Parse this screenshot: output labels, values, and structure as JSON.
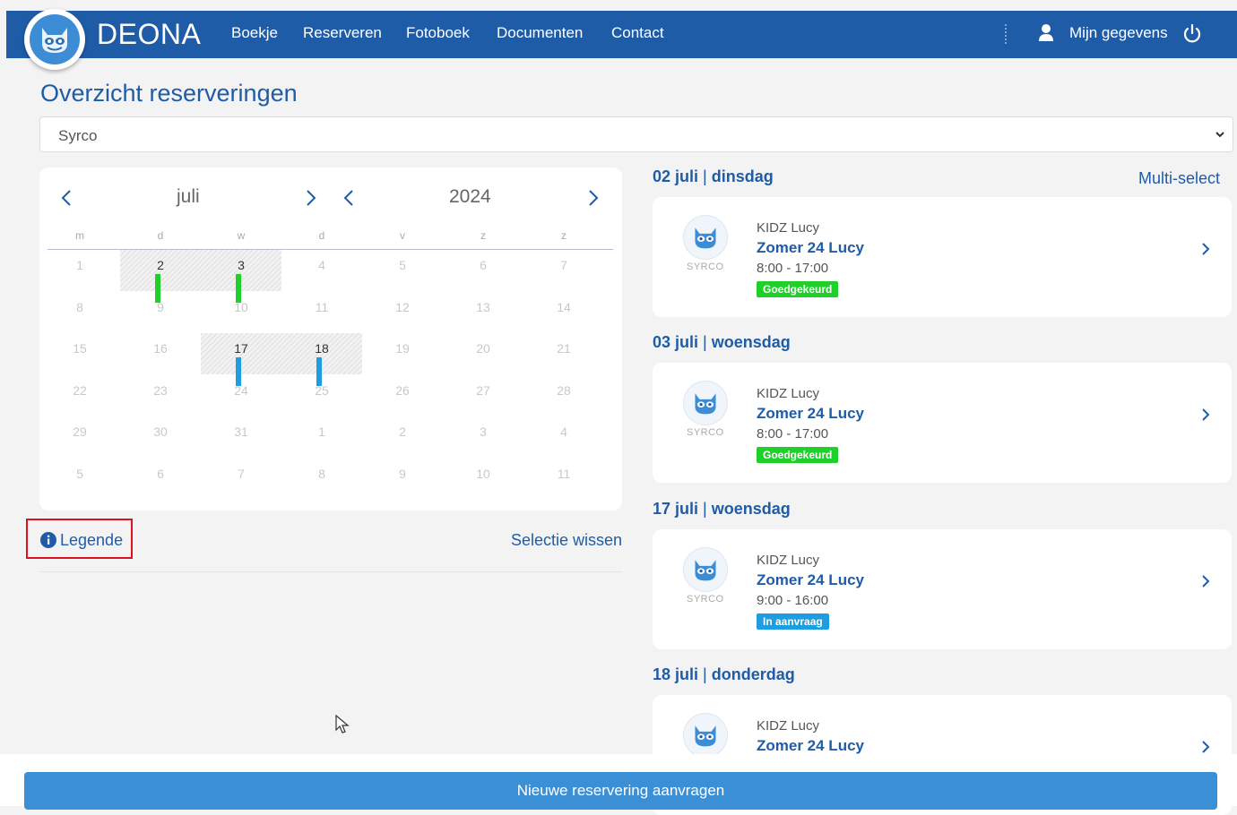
{
  "brand": "DEONA",
  "nav": [
    "Boekje",
    "Reserveren",
    "Fotoboek",
    "Documenten",
    "Contact"
  ],
  "user": {
    "label": "Mijn gegevens"
  },
  "page_title": "Overzicht reserveringen",
  "location_select": {
    "value": "Syrco"
  },
  "calendar": {
    "month": "juli",
    "year": "2024",
    "weekdays": [
      "m",
      "d",
      "w",
      "d",
      "v",
      "z",
      "z"
    ],
    "weeks": [
      [
        "1",
        "2",
        "3",
        "4",
        "5",
        "6",
        "7"
      ],
      [
        "8",
        "9",
        "10",
        "11",
        "12",
        "13",
        "14"
      ],
      [
        "15",
        "16",
        "17",
        "18",
        "19",
        "20",
        "21"
      ],
      [
        "22",
        "23",
        "24",
        "25",
        "26",
        "27",
        "28"
      ],
      [
        "29",
        "30",
        "31",
        "1",
        "2",
        "3",
        "4"
      ],
      [
        "5",
        "6",
        "7",
        "8",
        "9",
        "10",
        "11"
      ]
    ],
    "marked": [
      {
        "day": "2",
        "status": "approved"
      },
      {
        "day": "3",
        "status": "approved"
      },
      {
        "day": "17",
        "status": "requested"
      },
      {
        "day": "18",
        "status": "requested"
      }
    ],
    "colors": {
      "approved": "#1fcf2a",
      "requested": "#1d9ee0"
    }
  },
  "legend_label": "Legende",
  "clear_selection_label": "Selectie wissen",
  "multiselect_label": "Multi-select",
  "reservations": [
    {
      "date": "02 juli",
      "weekday": "dinsdag",
      "org": "KIDZ Lucy",
      "name": "Zomer 24 Lucy",
      "time": "8:00 - 17:00",
      "status": "Goedgekeurd",
      "status_color": "#1fcf2a",
      "logo_sub": "SYRCO"
    },
    {
      "date": "03 juli",
      "weekday": "woensdag",
      "org": "KIDZ Lucy",
      "name": "Zomer 24 Lucy",
      "time": "8:00 - 17:00",
      "status": "Goedgekeurd",
      "status_color": "#1fcf2a",
      "logo_sub": "SYRCO"
    },
    {
      "date": "17 juli",
      "weekday": "woensdag",
      "org": "KIDZ Lucy",
      "name": "Zomer 24 Lucy",
      "time": "9:00 - 16:00",
      "status": "In aanvraag",
      "status_color": "#1d9ee0",
      "logo_sub": "SYRCO"
    },
    {
      "date": "18 juli",
      "weekday": "donderdag",
      "org": "KIDZ Lucy",
      "name": "Zomer 24 Lucy"
    }
  ],
  "new_reservation_label": "Nieuwe reservering aanvragen",
  "theme": {
    "primary": "#1f5ca8",
    "button": "#3b8fd4",
    "highlight": "#e0111e"
  }
}
